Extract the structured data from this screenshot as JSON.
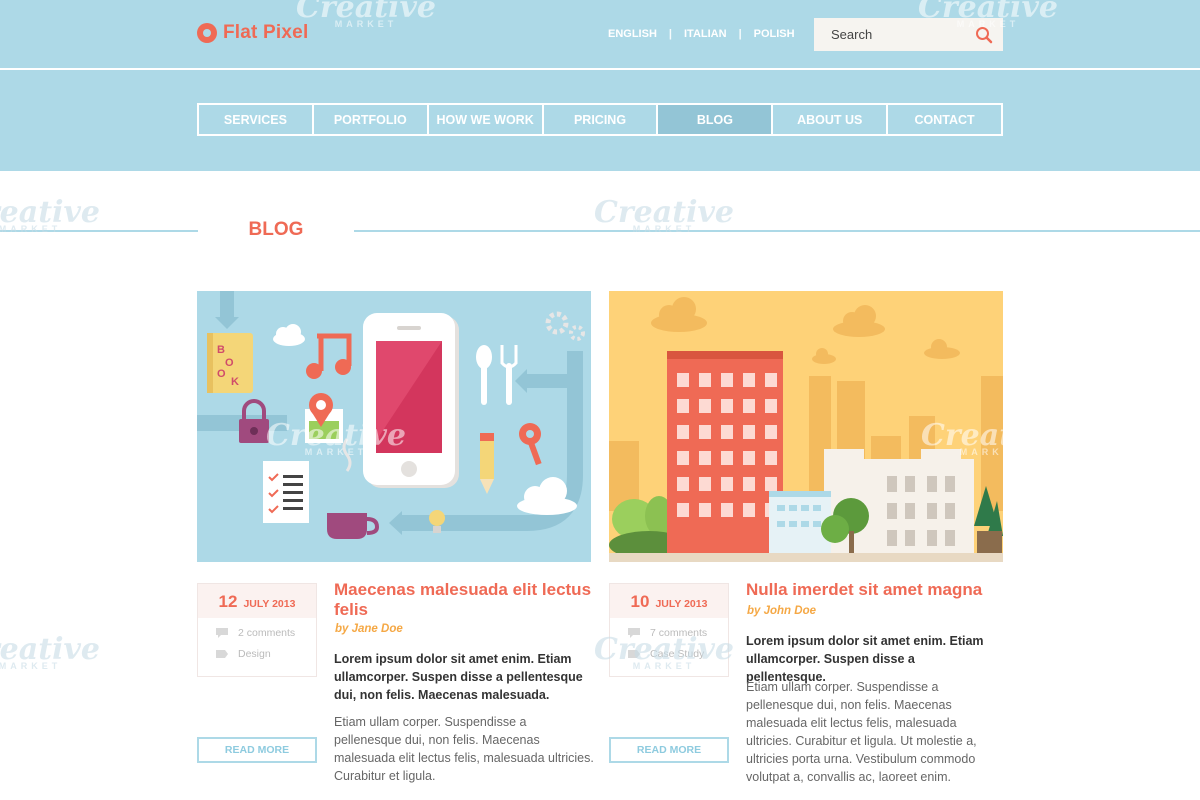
{
  "brand": {
    "name": "Flat Pixel",
    "accent_color": "#ef6a55",
    "header_color": "#add9e7"
  },
  "languages": [
    "ENGLISH",
    "ITALIAN",
    "POLISH"
  ],
  "search": {
    "placeholder": "Search",
    "icon": "search-icon"
  },
  "nav": {
    "items": [
      "SERVICES",
      "PORTFOLIO",
      "HOW WE WORK",
      "PRICING",
      "BLOG",
      "ABOUT US",
      "CONTACT"
    ],
    "active": "BLOG"
  },
  "section": {
    "title": "BLOG"
  },
  "posts": [
    {
      "day": "12",
      "month": "JULY 2013",
      "comments": "2 comments",
      "category": "Design",
      "title": "Maecenas malesuada elit lectus felis",
      "author": "by Jane Doe",
      "lead": "Lorem ipsum dolor sit amet enim. Etiam ullamcorper. Suspen disse a pellentesque dui, non felis. Maecenas malesuada.",
      "body": "Etiam ullam corper. Suspendisse a pellenesque dui, non felis. Maecenas malesuada elit lectus felis, malesuada ultricies. Curabitur et ligula.",
      "read_more": "READ MORE",
      "image": "flat-icons-smartphone-illustration"
    },
    {
      "day": "10",
      "month": "JULY 2013",
      "comments": "7 comments",
      "category": "Case Study",
      "title": "Nulla imerdet sit amet magna",
      "author": "by John Doe",
      "lead": "Lorem ipsum dolor sit amet enim. Etiam ullamcorper. Suspen disse a pellentesque.",
      "body": "Etiam ullam corper. Suspendisse a pellenesque dui, non felis. Maecenas malesuada elit lectus felis, malesuada ultricies. Curabitur et ligula. Ut molestie a, ultricies porta urna. Vestibulum commodo volutpat a, convallis ac, laoreet enim.",
      "read_more": "READ MORE",
      "image": "flat-city-buildings-illustration"
    }
  ],
  "watermark": {
    "text": "Creative",
    "sub": "MARKET"
  }
}
